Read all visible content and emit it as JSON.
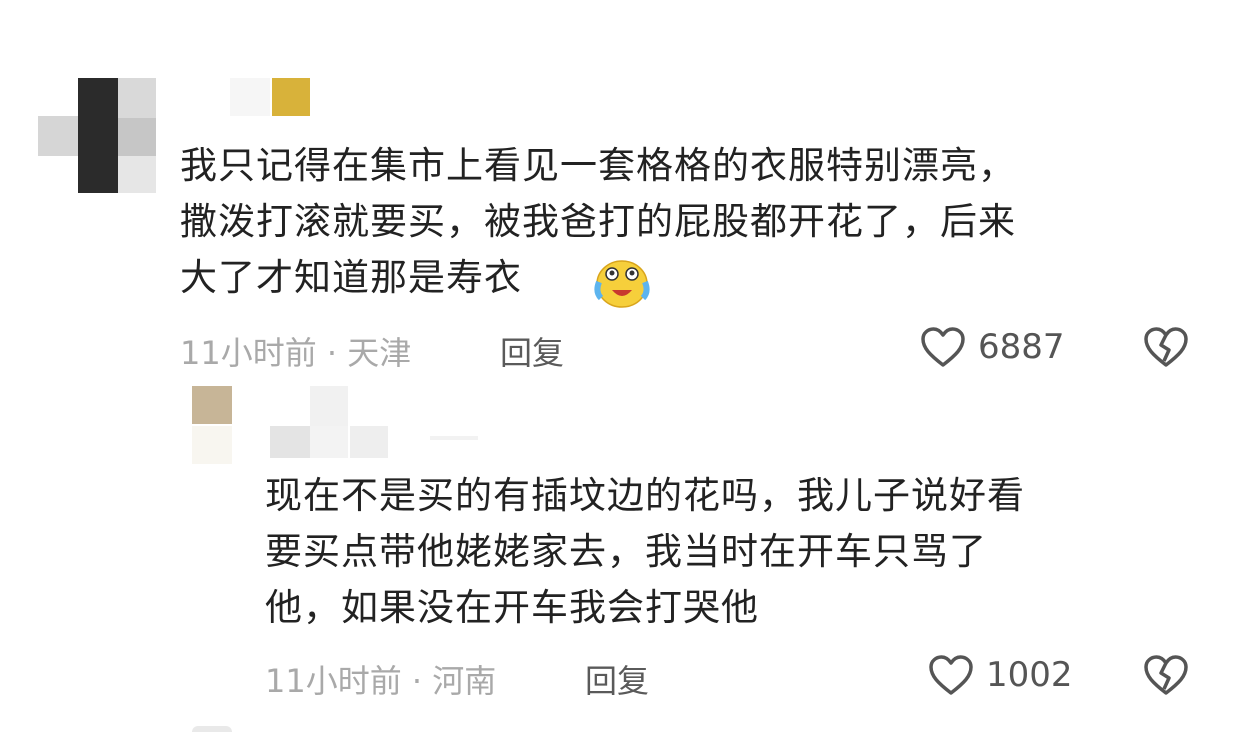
{
  "comments": [
    {
      "text": "我只记得在集市上看见一套格格的衣服特别漂亮，\n撒泼打滚就要买，被我爸打的屁股都开花了，后来\n大了才知道那是寿衣",
      "emoji": "laughing-crying-emoji",
      "time": "11小时前",
      "location": "天津",
      "reply_label": "回复",
      "likes": "6887"
    },
    {
      "text": "现在不是买的有插坟边的花吗，我儿子说好看\n要买点带他姥姥家去，我当时在开车只骂了\n他，如果没在开车我会打哭他",
      "time": "11小时前",
      "location": "河南",
      "reply_label": "回复",
      "likes": "1002"
    }
  ],
  "separator": "·",
  "icons": {
    "like": "heart-outline-icon",
    "dislike": "broken-heart-icon"
  },
  "colors": {
    "text": "#222222",
    "meta": "#a9a9a9",
    "icon": "#555555",
    "gold": "#d8b23a"
  }
}
